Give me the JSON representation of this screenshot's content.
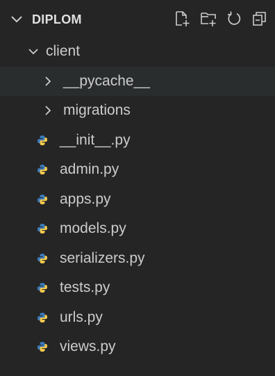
{
  "explorer": {
    "root_name": "DIPLOM",
    "actions": [
      {
        "icon": "new-file-icon"
      },
      {
        "icon": "new-folder-icon"
      },
      {
        "icon": "refresh-icon"
      },
      {
        "icon": "collapse-all-icon"
      }
    ],
    "tree": {
      "folder": "client",
      "subfolders": [
        "__pycache__",
        "migrations"
      ],
      "files": [
        "__init__.py",
        "admin.py",
        "apps.py",
        "models.py",
        "serializers.py",
        "tests.py",
        "urls.py",
        "views.py"
      ]
    }
  },
  "colors": {
    "background": "#252526",
    "text": "#cccccc",
    "python_blue": "#3d7ab8",
    "python_yellow": "#f2c94c"
  }
}
